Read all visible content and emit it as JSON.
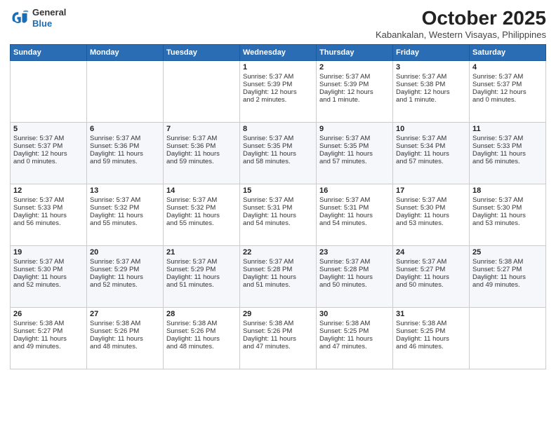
{
  "header": {
    "logo_general": "General",
    "logo_blue": "Blue",
    "month_title": "October 2025",
    "location": "Kabankalan, Western Visayas, Philippines"
  },
  "weekdays": [
    "Sunday",
    "Monday",
    "Tuesday",
    "Wednesday",
    "Thursday",
    "Friday",
    "Saturday"
  ],
  "weeks": [
    [
      {
        "day": "",
        "content": ""
      },
      {
        "day": "",
        "content": ""
      },
      {
        "day": "",
        "content": ""
      },
      {
        "day": "1",
        "content": "Sunrise: 5:37 AM\nSunset: 5:39 PM\nDaylight: 12 hours\nand 2 minutes."
      },
      {
        "day": "2",
        "content": "Sunrise: 5:37 AM\nSunset: 5:39 PM\nDaylight: 12 hours\nand 1 minute."
      },
      {
        "day": "3",
        "content": "Sunrise: 5:37 AM\nSunset: 5:38 PM\nDaylight: 12 hours\nand 1 minute."
      },
      {
        "day": "4",
        "content": "Sunrise: 5:37 AM\nSunset: 5:37 PM\nDaylight: 12 hours\nand 0 minutes."
      }
    ],
    [
      {
        "day": "5",
        "content": "Sunrise: 5:37 AM\nSunset: 5:37 PM\nDaylight: 12 hours\nand 0 minutes."
      },
      {
        "day": "6",
        "content": "Sunrise: 5:37 AM\nSunset: 5:36 PM\nDaylight: 11 hours\nand 59 minutes."
      },
      {
        "day": "7",
        "content": "Sunrise: 5:37 AM\nSunset: 5:36 PM\nDaylight: 11 hours\nand 59 minutes."
      },
      {
        "day": "8",
        "content": "Sunrise: 5:37 AM\nSunset: 5:35 PM\nDaylight: 11 hours\nand 58 minutes."
      },
      {
        "day": "9",
        "content": "Sunrise: 5:37 AM\nSunset: 5:35 PM\nDaylight: 11 hours\nand 57 minutes."
      },
      {
        "day": "10",
        "content": "Sunrise: 5:37 AM\nSunset: 5:34 PM\nDaylight: 11 hours\nand 57 minutes."
      },
      {
        "day": "11",
        "content": "Sunrise: 5:37 AM\nSunset: 5:33 PM\nDaylight: 11 hours\nand 56 minutes."
      }
    ],
    [
      {
        "day": "12",
        "content": "Sunrise: 5:37 AM\nSunset: 5:33 PM\nDaylight: 11 hours\nand 56 minutes."
      },
      {
        "day": "13",
        "content": "Sunrise: 5:37 AM\nSunset: 5:32 PM\nDaylight: 11 hours\nand 55 minutes."
      },
      {
        "day": "14",
        "content": "Sunrise: 5:37 AM\nSunset: 5:32 PM\nDaylight: 11 hours\nand 55 minutes."
      },
      {
        "day": "15",
        "content": "Sunrise: 5:37 AM\nSunset: 5:31 PM\nDaylight: 11 hours\nand 54 minutes."
      },
      {
        "day": "16",
        "content": "Sunrise: 5:37 AM\nSunset: 5:31 PM\nDaylight: 11 hours\nand 54 minutes."
      },
      {
        "day": "17",
        "content": "Sunrise: 5:37 AM\nSunset: 5:30 PM\nDaylight: 11 hours\nand 53 minutes."
      },
      {
        "day": "18",
        "content": "Sunrise: 5:37 AM\nSunset: 5:30 PM\nDaylight: 11 hours\nand 53 minutes."
      }
    ],
    [
      {
        "day": "19",
        "content": "Sunrise: 5:37 AM\nSunset: 5:30 PM\nDaylight: 11 hours\nand 52 minutes."
      },
      {
        "day": "20",
        "content": "Sunrise: 5:37 AM\nSunset: 5:29 PM\nDaylight: 11 hours\nand 52 minutes."
      },
      {
        "day": "21",
        "content": "Sunrise: 5:37 AM\nSunset: 5:29 PM\nDaylight: 11 hours\nand 51 minutes."
      },
      {
        "day": "22",
        "content": "Sunrise: 5:37 AM\nSunset: 5:28 PM\nDaylight: 11 hours\nand 51 minutes."
      },
      {
        "day": "23",
        "content": "Sunrise: 5:37 AM\nSunset: 5:28 PM\nDaylight: 11 hours\nand 50 minutes."
      },
      {
        "day": "24",
        "content": "Sunrise: 5:37 AM\nSunset: 5:27 PM\nDaylight: 11 hours\nand 50 minutes."
      },
      {
        "day": "25",
        "content": "Sunrise: 5:38 AM\nSunset: 5:27 PM\nDaylight: 11 hours\nand 49 minutes."
      }
    ],
    [
      {
        "day": "26",
        "content": "Sunrise: 5:38 AM\nSunset: 5:27 PM\nDaylight: 11 hours\nand 49 minutes."
      },
      {
        "day": "27",
        "content": "Sunrise: 5:38 AM\nSunset: 5:26 PM\nDaylight: 11 hours\nand 48 minutes."
      },
      {
        "day": "28",
        "content": "Sunrise: 5:38 AM\nSunset: 5:26 PM\nDaylight: 11 hours\nand 48 minutes."
      },
      {
        "day": "29",
        "content": "Sunrise: 5:38 AM\nSunset: 5:26 PM\nDaylight: 11 hours\nand 47 minutes."
      },
      {
        "day": "30",
        "content": "Sunrise: 5:38 AM\nSunset: 5:25 PM\nDaylight: 11 hours\nand 47 minutes."
      },
      {
        "day": "31",
        "content": "Sunrise: 5:38 AM\nSunset: 5:25 PM\nDaylight: 11 hours\nand 46 minutes."
      },
      {
        "day": "",
        "content": ""
      }
    ]
  ]
}
